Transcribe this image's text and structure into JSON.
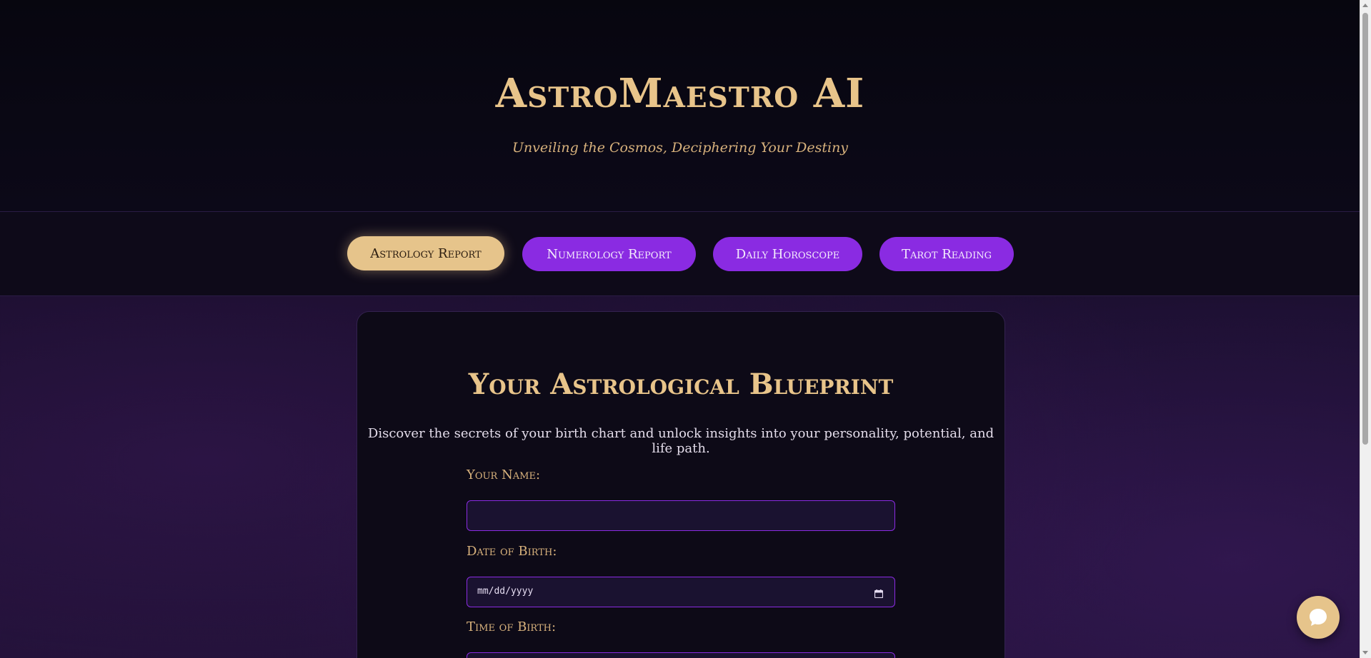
{
  "header": {
    "title": "AstroMaestro AI",
    "tagline": "Unveiling the Cosmos, Deciphering Your Destiny"
  },
  "nav": {
    "items": [
      {
        "label": "Astrology Report",
        "active": true
      },
      {
        "label": "Numerology Report",
        "active": false
      },
      {
        "label": "Daily Horoscope",
        "active": false
      },
      {
        "label": "Tarot Reading",
        "active": false
      }
    ]
  },
  "card": {
    "title": "Your Astrological Blueprint",
    "description": "Discover the secrets of your birth chart and unlock insights into your personality, potential, and life path.",
    "fields": {
      "name": {
        "label": "Your Name:",
        "value": ""
      },
      "dob": {
        "label": "Date of Birth:",
        "placeholder": "mm/dd/yyyy"
      },
      "tob": {
        "label": "Time of Birth:"
      }
    }
  },
  "colors": {
    "accent_gold": "#e8c48a",
    "accent_purple": "#8a2be2",
    "background": "#0d0a17"
  },
  "icons": {
    "calendar": "calendar-icon",
    "chat": "chat-bubble-icon"
  }
}
